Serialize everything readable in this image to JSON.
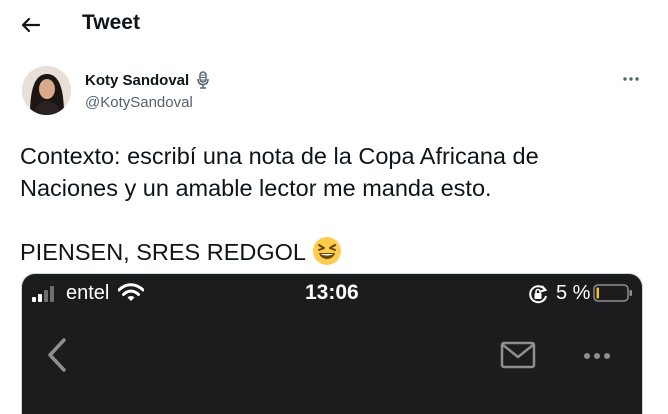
{
  "header": {
    "title": "Tweet",
    "back_icon": "back-arrow-icon"
  },
  "author": {
    "name": "Koty Sandoval",
    "handle": "@KotySandoval",
    "badge_icon": "microphone-icon",
    "avatar": "avatar-photo"
  },
  "menu_icon": "more-horizontal-icon",
  "tweet": {
    "line1": "Contexto: escribí una nota de la Copa Africana de Naciones y un amable lector me manda esto.",
    "line2": "PIENSEN, SRES REDGOL",
    "emoji": "grinning-squinting-face-emoji"
  },
  "media": {
    "status_bar": {
      "carrier": "entel",
      "time": "13:06",
      "battery": "5 %",
      "battery_level": 0.05,
      "icons": [
        "signal-icon",
        "wifi-icon",
        "rotation-lock-icon",
        "battery-icon"
      ]
    },
    "toolbar_icons": [
      "chevron-left-icon",
      "mail-icon",
      "more-horizontal-icon"
    ]
  },
  "colors": {
    "text": "#0f1419",
    "secondary": "#536471",
    "media_bg": "#1c1c1e",
    "battery_low": "#f5c518"
  }
}
